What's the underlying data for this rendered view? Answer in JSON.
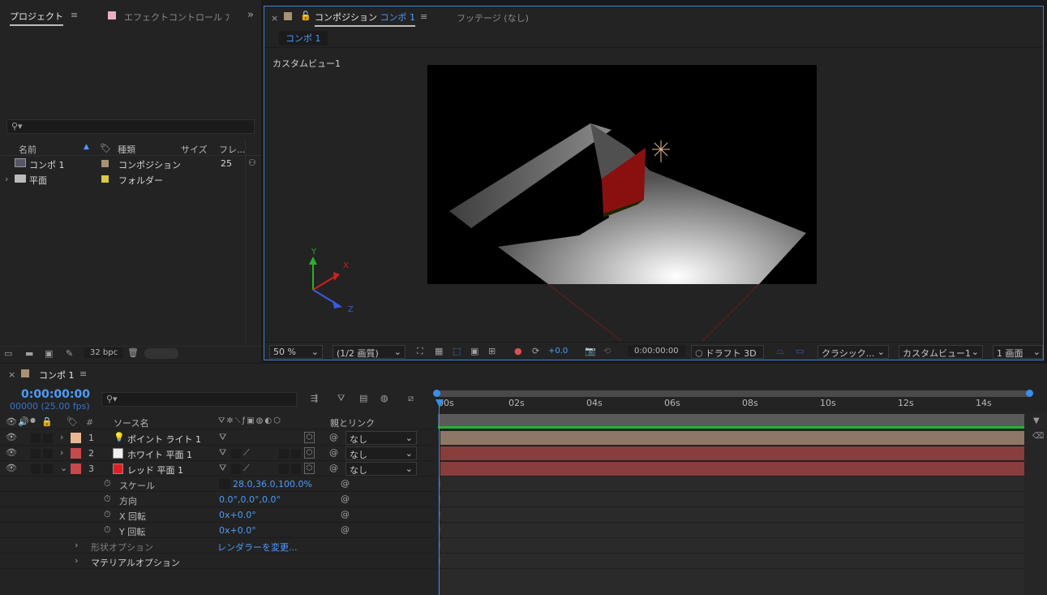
{
  "project": {
    "tab_project": "プロジェクト",
    "tab_effect": "エフェクトコントロール ﾌ",
    "search_placeholder": "",
    "columns": {
      "name": "名前",
      "type": "種類",
      "size": "サイズ",
      "frame": "フレ..."
    },
    "items": [
      {
        "name": "コンポ 1",
        "type": "コンポジション",
        "frames": "25",
        "label_color": "#a89274"
      },
      {
        "name": "平面",
        "type": "フォルダー",
        "frames": "",
        "label_color": "#d8c84a"
      }
    ],
    "bpc": "32 bpc"
  },
  "viewer": {
    "tab_comp_prefix": "コンポジション",
    "tab_comp_name": "コンポ 1",
    "tab_footage": "フッテージ (なし)",
    "comp_chip": "コンポ 1",
    "view_label": "カスタムビュー1",
    "axis": {
      "x": "X",
      "y": "Y",
      "z": "Z"
    },
    "zoom": "50 %",
    "quality": "(1/2 画質)",
    "exposure": "+0.0",
    "timecode": "0:00:00:00",
    "draft3d": "ドラフト 3D",
    "renderer": "クラシック...",
    "view": "カスタムビュー1",
    "layout": "1 画面"
  },
  "timeline": {
    "comp_tab": "コンポ 1",
    "time": "0:00:00:00",
    "frames": "00000 (25.00 fps)",
    "col_source": "ソース名",
    "col_parent": "親とリンク",
    "col_num": "#",
    "ruler": [
      "00s",
      "02s",
      "04s",
      "06s",
      "08s",
      "10s",
      "12s",
      "14s"
    ],
    "layers": [
      {
        "num": "1",
        "name": "ポイント ライト 1",
        "parent": "なし",
        "label": "#e8b894",
        "swatch": "#e8b894",
        "bar": "#8d7766"
      },
      {
        "num": "2",
        "name": "ホワイト 平面 1",
        "parent": "なし",
        "label": "#c84a4a",
        "swatch": "#f0f0f0",
        "bar": "#8a3d3d"
      },
      {
        "num": "3",
        "name": "レッド 平面 1",
        "parent": "なし",
        "label": "#c84a4a",
        "swatch": "#e02020",
        "bar": "#8a3d3d"
      }
    ],
    "props": [
      {
        "name": "スケール",
        "value": "28.0,36.0,100.0%"
      },
      {
        "name": "方向",
        "value": "0.0°,0.0°,0.0°"
      },
      {
        "name": "X 回転",
        "value": "0x+0.0°"
      },
      {
        "name": "Y 回転",
        "value": "0x+0.0°"
      }
    ],
    "groups": [
      {
        "name": "形状オプション",
        "link": "レンダラーを変更..."
      },
      {
        "name": "マテリアルオプション",
        "link": ""
      }
    ]
  }
}
